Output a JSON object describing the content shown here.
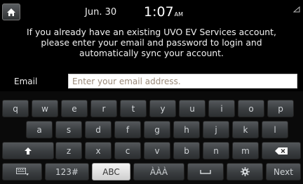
{
  "status": {
    "date": "Jun. 30",
    "time": "1:07",
    "ampm": "AM"
  },
  "message": {
    "line1": "If you already have an existing UVO EV Services account,",
    "line2": "please enter your email and password to login and",
    "line3": "automatically sync your account."
  },
  "form": {
    "email_label": "Email",
    "email_placeholder": "Enter your email address."
  },
  "keyboard": {
    "row1": [
      "q",
      "w",
      "e",
      "r",
      "t",
      "y",
      "u",
      "i",
      "o",
      "p"
    ],
    "row2": [
      "a",
      "s",
      "d",
      "f",
      "g",
      "h",
      "j",
      "k",
      "l"
    ],
    "row3": [
      "z",
      "x",
      "c",
      "v",
      "b",
      "n",
      "m"
    ],
    "bottom": {
      "numbers": "123#",
      "abc": "ABC",
      "accents": "ÀÀÀ",
      "next": "Next"
    },
    "active_mode": "ABC"
  },
  "icons": {
    "home": "home-icon",
    "signal": "signal-icon",
    "shift": "shift-icon",
    "backspace": "backspace-icon",
    "hide_keyboard": "hide-keyboard-icon",
    "space": "space-icon",
    "settings": "gear-icon"
  },
  "colors": {
    "background": "#000000",
    "key": "#3a3d40",
    "active_key": "#eeeeee",
    "input_placeholder": "#9a8a7a"
  }
}
